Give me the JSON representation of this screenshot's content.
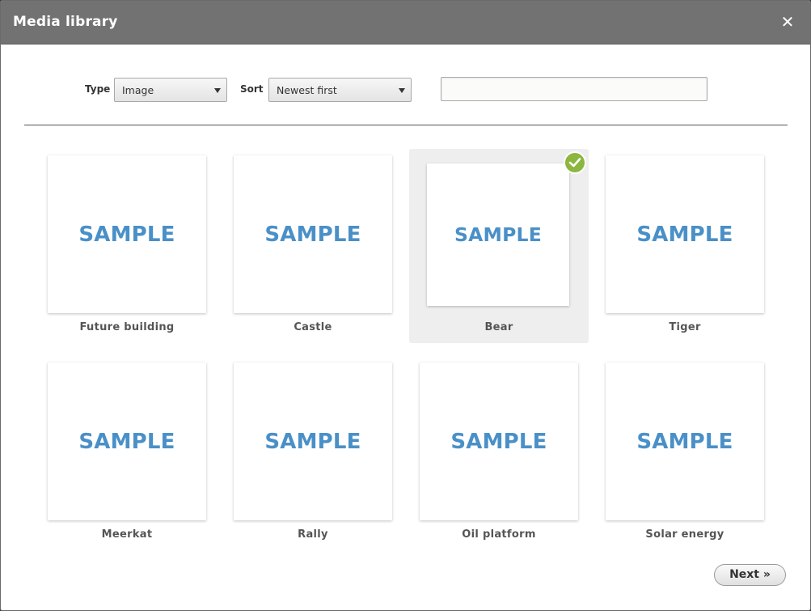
{
  "dialog": {
    "title": "Media library",
    "close_glyph": "✕"
  },
  "filters": {
    "type_label": "Type",
    "type_value": "Image",
    "sort_label": "Sort",
    "sort_value": "Newest first",
    "search_value": ""
  },
  "items": [
    {
      "thumb_text": "SAMPLE",
      "caption": "Future building"
    },
    {
      "thumb_text": "SAMPLE",
      "caption": "Castle"
    },
    {
      "thumb_text": "SAMPLE",
      "caption": "Bear"
    },
    {
      "thumb_text": "SAMPLE",
      "caption": "Tiger"
    },
    {
      "thumb_text": "SAMPLE",
      "caption": "Meerkat"
    },
    {
      "thumb_text": "SAMPLE",
      "caption": "Rally"
    },
    {
      "thumb_text": "SAMPLE",
      "caption": "Oil platform"
    },
    {
      "thumb_text": "SAMPLE",
      "caption": "Solar energy"
    }
  ],
  "selected_item": "Bear",
  "footer": {
    "next_label": "Next »"
  },
  "colors": {
    "titlebar": "#727272",
    "sample_text": "#4a90c8",
    "check_badge": "#8cb63e"
  }
}
